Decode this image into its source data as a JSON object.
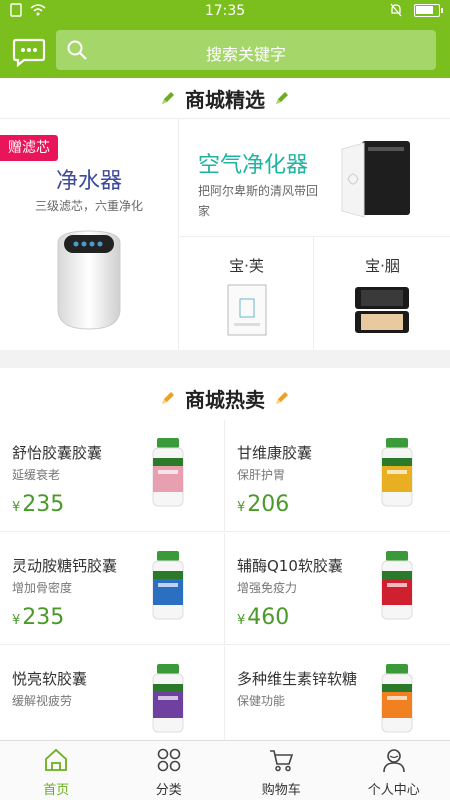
{
  "status_bar": {
    "time": "17:35",
    "battery_level": 0.8
  },
  "header": {
    "search_placeholder": "搜索关键字",
    "chat_icon": "chat-bubble-icon",
    "search_icon": "search-icon"
  },
  "featured": {
    "title": "商城精选",
    "main_card": {
      "badge": "赠滤芯",
      "title": "净水器",
      "subtitle": "三级滤芯，六重净化"
    },
    "air_card": {
      "title": "空气净化器",
      "subtitle": "把阿尔卑斯的清风带回家"
    },
    "small_cards": [
      {
        "label": "宝·芙"
      },
      {
        "label": "宝·胭"
      }
    ]
  },
  "hot": {
    "title": "商城热卖",
    "currency": "¥",
    "items": [
      {
        "name": "舒怡胶囊胶囊",
        "desc": "延缓衰老",
        "price": "235",
        "label_color": "#e8a0b0"
      },
      {
        "name": "甘维康胶囊",
        "desc": "保肝护胃",
        "price": "206",
        "label_color": "#e8b020"
      },
      {
        "name": "灵动胺糖钙胶囊",
        "desc": "增加骨密度",
        "price": "235",
        "label_color": "#2a6fc0"
      },
      {
        "name": "辅酶Q10软胶囊",
        "desc": "增强免疫力",
        "price": "460",
        "label_color": "#d02030"
      },
      {
        "name": "悦亮软胶囊",
        "desc": "缓解视疲劳",
        "price": "",
        "label_color": "#7040a0"
      },
      {
        "name": "多种维生素锌软糖",
        "desc": "保健功能",
        "price": "",
        "label_color": "#f08020"
      }
    ]
  },
  "bottom_nav": [
    {
      "label": "首页",
      "icon": "home-icon",
      "active": true
    },
    {
      "label": "分类",
      "icon": "category-icon",
      "active": false
    },
    {
      "label": "购物车",
      "icon": "cart-icon",
      "active": false
    },
    {
      "label": "个人中心",
      "icon": "user-icon",
      "active": false
    }
  ],
  "colors": {
    "brand": "#7bbf1e",
    "price": "#4a9a2a",
    "badge": "#e8155a"
  }
}
